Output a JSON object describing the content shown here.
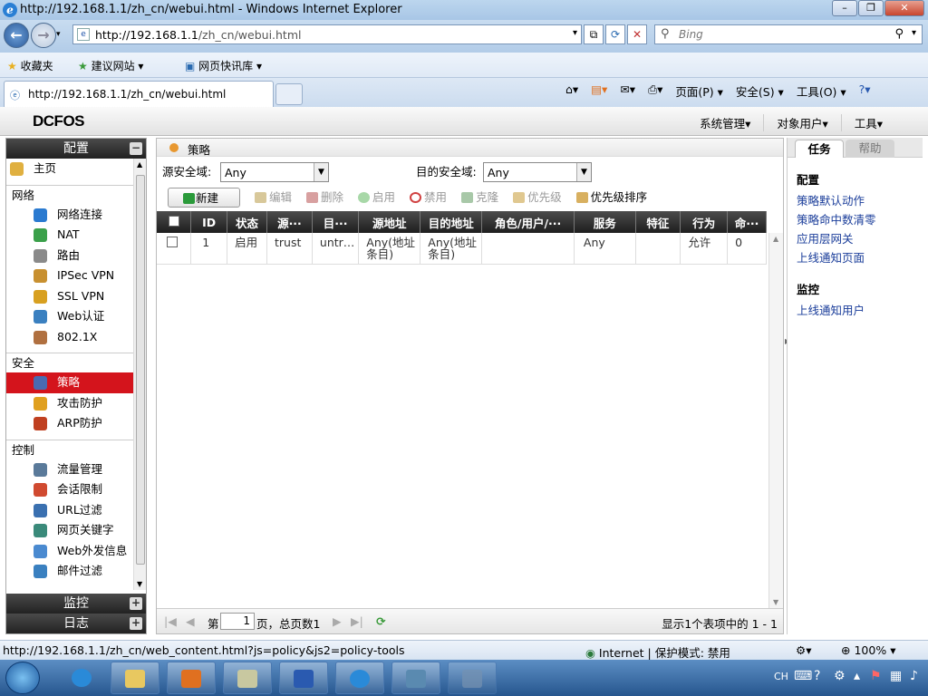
{
  "window": {
    "title": "http://192.168.1.1/zh_cn/webui.html - Windows Internet Explorer",
    "min": "–",
    "max": "❐",
    "close": "✕"
  },
  "nav": {
    "url_host": "http://192.168.1.1",
    "url_path": "/zh_cn/webui.html",
    "search_placeholder": "Bing"
  },
  "favbar": {
    "favorites": "收藏夹",
    "suggested": "建议网站 ▾",
    "slices": "网页快讯库 ▾"
  },
  "tab": {
    "title": "http://192.168.1.1/zh_cn/webui.html"
  },
  "commands": {
    "page": "页面(P) ▾",
    "safety": "安全(S) ▾",
    "tools": "工具(O) ▾"
  },
  "app": {
    "logo": "DCFOS",
    "topmenu": [
      "系统管理▾",
      "对象用户▾",
      "工具▾"
    ]
  },
  "sidebar": {
    "header": "配置",
    "home": "主页",
    "sections": [
      {
        "title": "网络",
        "items": [
          "网络连接",
          "NAT",
          "路由",
          "IPSec VPN",
          "SSL VPN",
          "Web认证",
          "802.1X"
        ]
      },
      {
        "title": "安全",
        "items": [
          "策略",
          "攻击防护",
          "ARP防护"
        ]
      },
      {
        "title": "控制",
        "items": [
          "流量管理",
          "会话限制",
          "URL过滤",
          "网页关键字",
          "Web外发信息",
          "邮件过滤"
        ]
      }
    ],
    "selected": "策略",
    "footers": [
      "监控",
      "日志"
    ],
    "icon_colors": [
      "#2a7ad0",
      "#3aa04a",
      "#8a8a8a",
      "#c89030",
      "#d8a020",
      "#3a80c0",
      "#b07040",
      "#4a6ab0",
      "#e0a020",
      "#c04020",
      "#5a7a9a",
      "#d04a30",
      "#3a70b0",
      "#3a8a7a",
      "#4a8ad0",
      "#3a80c0"
    ]
  },
  "main": {
    "breadcrumb": "策略",
    "src_zone_label": "源安全域:",
    "src_zone_value": "Any",
    "dst_zone_label": "目的安全域:",
    "dst_zone_value": "Any",
    "tools": [
      "新建",
      "编辑",
      "删除",
      "启用",
      "禁用",
      "克隆",
      "优先级",
      "优先级排序"
    ],
    "columns": [
      "ID",
      "状态",
      "源···",
      "目···",
      "源地址",
      "目的地址",
      "角色/用户/···",
      "服务",
      "特征",
      "行为",
      "命···"
    ],
    "rows": [
      {
        "id": "1",
        "status": "启用",
        "src": "trust",
        "dst": "untr…",
        "src_addr_1": "Any(地址",
        "src_addr_2": "条目)",
        "dst_addr_1": "Any(地址",
        "dst_addr_2": "条目)",
        "role": "",
        "service": "Any",
        "feature": "",
        "action": "允许",
        "hits": "0"
      }
    ],
    "pager": {
      "page_prefix": "第",
      "page_value": "1",
      "page_suffix": "页，总页数1",
      "summary": "显示1个表项中的 1 - 1"
    }
  },
  "right": {
    "tabs": [
      "任务",
      "帮助"
    ],
    "sections": [
      {
        "title": "配置",
        "links": [
          "策略默认动作",
          "策略命中数清零",
          "应用层网关",
          "上线通知页面"
        ]
      },
      {
        "title": "监控",
        "links": [
          "上线通知用户"
        ]
      }
    ]
  },
  "status": {
    "url": "http://192.168.1.1/zh_cn/web_content.html?js=policy&js2=policy-tools",
    "zone": "Internet | 保护模式: 禁用",
    "zoom": "100%"
  },
  "tray": {
    "lang": "CH"
  }
}
